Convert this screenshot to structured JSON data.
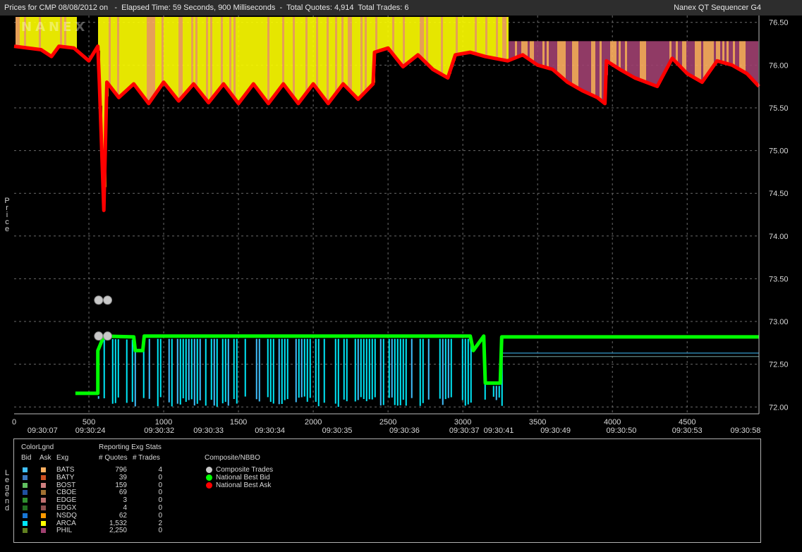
{
  "header": {
    "title_left": "Prices for CMP 08/08/2012 on   -  Elapsed Time: 59 Seconds, 900 Milliseconds  -  Total Quotes: 4,914  Total Trades: 6",
    "title_right": "Nanex QT Sequencer G4"
  },
  "side_labels": {
    "price": [
      "P",
      "r",
      "i",
      "c",
      "e"
    ],
    "legend": [
      "L",
      "e",
      "g",
      "e",
      "n",
      "d"
    ]
  },
  "chart_data": {
    "type": "line",
    "ylim": [
      71.92,
      76.58
    ],
    "xlim": [
      0,
      4980
    ],
    "y_ticks": [
      "72.00",
      "72.50",
      "73.00",
      "73.50",
      "74.00",
      "74.50",
      "75.00",
      "75.50",
      "76.00",
      "76.50"
    ],
    "x_ticks_top": [
      {
        "x": 0,
        "label": "0"
      },
      {
        "x": 500,
        "label": "500"
      },
      {
        "x": 1000,
        "label": "1000"
      },
      {
        "x": 1500,
        "label": "1500"
      },
      {
        "x": 2000,
        "label": "2000"
      },
      {
        "x": 2500,
        "label": "2500"
      },
      {
        "x": 3000,
        "label": "3000"
      },
      {
        "x": 3500,
        "label": "3500"
      },
      {
        "x": 4000,
        "label": "4000"
      },
      {
        "x": 4500,
        "label": "4500"
      }
    ],
    "x_ticks_bottom": [
      {
        "x": 190,
        "label": "09:30:07"
      },
      {
        "x": 510,
        "label": "09:30:24"
      },
      {
        "x": 970,
        "label": "09:30:32"
      },
      {
        "x": 1300,
        "label": "09:30:33"
      },
      {
        "x": 1710,
        "label": "09:30:34"
      },
      {
        "x": 2160,
        "label": "09:30:35"
      },
      {
        "x": 2610,
        "label": "09:30:36"
      },
      {
        "x": 3010,
        "label": "09:30:37"
      },
      {
        "x": 3240,
        "label": "09:30:41"
      },
      {
        "x": 3620,
        "label": "09:30:49"
      },
      {
        "x": 4060,
        "label": "09:30:50"
      },
      {
        "x": 4500,
        "label": "09:30:53"
      },
      {
        "x": 4890,
        "label": "09:30:58"
      }
    ],
    "series": [
      {
        "name": "National Best Bid",
        "color": "#00ff00",
        "points": [
          [
            410,
            72.16
          ],
          [
            560,
            72.16
          ],
          [
            560,
            72.66
          ],
          [
            600,
            72.83
          ],
          [
            800,
            72.82
          ],
          [
            810,
            72.66
          ],
          [
            860,
            72.66
          ],
          [
            870,
            72.83
          ],
          [
            3050,
            72.83
          ],
          [
            3070,
            72.66
          ],
          [
            3140,
            72.83
          ],
          [
            3150,
            72.28
          ],
          [
            3250,
            72.28
          ],
          [
            3260,
            72.82
          ],
          [
            4980,
            72.82
          ]
        ]
      },
      {
        "name": "National Best Ask",
        "color": "#ff0000",
        "points": [
          [
            0,
            76.22
          ],
          [
            180,
            76.18
          ],
          [
            250,
            76.1
          ],
          [
            300,
            76.22
          ],
          [
            400,
            76.2
          ],
          [
            500,
            76.05
          ],
          [
            560,
            76.22
          ],
          [
            570,
            75.79
          ],
          [
            600,
            74.3
          ],
          [
            620,
            75.8
          ],
          [
            700,
            75.62
          ],
          [
            800,
            75.78
          ],
          [
            900,
            75.55
          ],
          [
            1000,
            75.8
          ],
          [
            1100,
            75.58
          ],
          [
            1200,
            75.78
          ],
          [
            1300,
            75.56
          ],
          [
            1400,
            75.78
          ],
          [
            1500,
            75.55
          ],
          [
            1600,
            75.78
          ],
          [
            1700,
            75.55
          ],
          [
            1800,
            75.78
          ],
          [
            1900,
            75.55
          ],
          [
            2000,
            75.78
          ],
          [
            2100,
            75.55
          ],
          [
            2200,
            75.78
          ],
          [
            2300,
            75.6
          ],
          [
            2400,
            75.78
          ],
          [
            2410,
            76.15
          ],
          [
            2500,
            76.2
          ],
          [
            2600,
            75.98
          ],
          [
            2700,
            76.12
          ],
          [
            2800,
            75.95
          ],
          [
            2900,
            75.85
          ],
          [
            2950,
            76.12
          ],
          [
            3050,
            76.15
          ],
          [
            3150,
            76.1
          ],
          [
            3300,
            76.05
          ],
          [
            3400,
            76.12
          ],
          [
            3500,
            76.0
          ],
          [
            3600,
            75.95
          ],
          [
            3700,
            75.8
          ],
          [
            3800,
            75.7
          ],
          [
            3900,
            75.62
          ],
          [
            3950,
            75.55
          ],
          [
            3960,
            76.05
          ],
          [
            4050,
            75.95
          ],
          [
            4150,
            75.85
          ],
          [
            4300,
            75.75
          ],
          [
            4400,
            76.08
          ],
          [
            4500,
            75.9
          ],
          [
            4600,
            75.8
          ],
          [
            4700,
            76.05
          ],
          [
            4800,
            76.0
          ],
          [
            4900,
            75.9
          ],
          [
            4980,
            75.75
          ]
        ]
      },
      {
        "name": "Composite Trades",
        "color": "#c8c8c8",
        "points": [
          [
            565,
            73.25
          ],
          [
            565,
            72.83
          ],
          [
            625,
            73.25
          ],
          [
            625,
            72.83
          ]
        ]
      }
    ],
    "legend": {
      "headers": {
        "colorlgnd": "ColorLgnd",
        "bid": "Bid",
        "ask": "Ask",
        "exg": "Exg",
        "reporting": "Reporting Exg Stats",
        "quotes": "# Quotes",
        "trades": "# Trades",
        "composite": "Composite/NBBO"
      },
      "exchanges": [
        {
          "name": "BATS",
          "bid": "#40c0ff",
          "ask": "#ffb060",
          "quotes": "796",
          "trades": "4"
        },
        {
          "name": "BATY",
          "bid": "#3a78c0",
          "ask": "#d05020",
          "quotes": "39",
          "trades": "0"
        },
        {
          "name": "BOST",
          "bid": "#60c060",
          "ask": "#d08080",
          "quotes": "159",
          "trades": "0"
        },
        {
          "name": "CBOE",
          "bid": "#2050a0",
          "ask": "#a07030",
          "quotes": "69",
          "trades": "0"
        },
        {
          "name": "EDGE",
          "bid": "#309030",
          "ask": "#c07070",
          "quotes": "3",
          "trades": "0"
        },
        {
          "name": "EDGX",
          "bid": "#207020",
          "ask": "#905050",
          "quotes": "4",
          "trades": "0"
        },
        {
          "name": "NSDQ",
          "bid": "#1878d8",
          "ask": "#ff9a00",
          "quotes": "62",
          "trades": "0"
        },
        {
          "name": "ARCA",
          "bid": "#00e8f8",
          "ask": "#ffff00",
          "quotes": "1,532",
          "trades": "2"
        },
        {
          "name": "PHIL",
          "bid": "#608020",
          "ask": "#a04070",
          "quotes": "2,250",
          "trades": "0"
        }
      ],
      "composite": [
        {
          "name": "Composite Trades",
          "color": "#c8c8c8"
        },
        {
          "name": "National Best Bid",
          "color": "#00ff00"
        },
        {
          "name": "National Best Ask",
          "color": "#ff0000"
        }
      ]
    }
  }
}
